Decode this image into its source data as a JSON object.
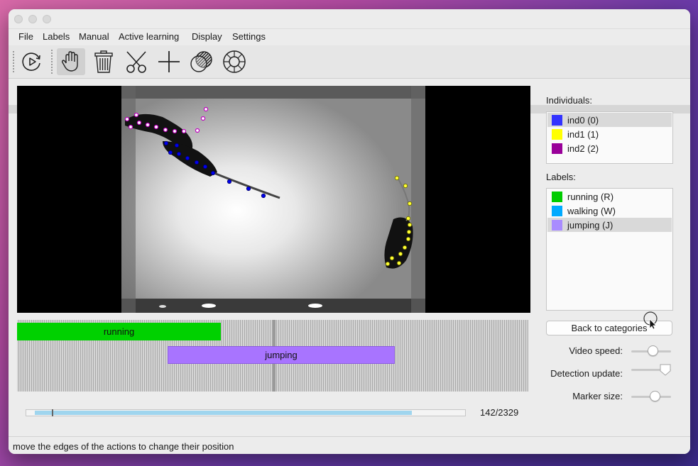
{
  "menu": {
    "items": [
      "File",
      "Labels",
      "Manual",
      "Active learning",
      "Display",
      "Settings"
    ]
  },
  "toolbar": {
    "buttons": [
      {
        "icon": "play-circle-icon"
      },
      {
        "icon": "hand-icon",
        "active": true
      },
      {
        "icon": "trash-icon"
      },
      {
        "icon": "scissors-icon"
      },
      {
        "icon": "plus-icon"
      },
      {
        "icon": "overlap-circles-icon"
      },
      {
        "icon": "lifebuoy-icon"
      }
    ]
  },
  "timeline": {
    "rows": [
      {
        "label": "running",
        "color": "#00d100",
        "start_frac": 0.0,
        "end_frac": 0.398
      },
      {
        "label": "jumping",
        "color": "#a874ff",
        "start_frac": 0.294,
        "end_frac": 0.739
      }
    ]
  },
  "progress": {
    "fill_start_frac": 0.02,
    "fill_end_frac": 0.879,
    "counter": "142/2329"
  },
  "sidebar": {
    "individuals_title": "Individuals:",
    "individuals": [
      {
        "label": "ind0 (0)",
        "color": "#3333ff",
        "selected": true
      },
      {
        "label": "ind1 (1)",
        "color": "#ffff00",
        "selected": false
      },
      {
        "label": "ind2 (2)",
        "color": "#990099",
        "selected": false
      }
    ],
    "labels_title": "Labels:",
    "labels": [
      {
        "label": "running (R)",
        "color": "#00cc00",
        "selected": false
      },
      {
        "label": "walking (W)",
        "color": "#00aaff",
        "selected": false
      },
      {
        "label": "jumping (J)",
        "color": "#a98cff",
        "selected": true
      }
    ],
    "back_button": "Back to categories",
    "sliders": [
      {
        "label": "Video speed:",
        "value": 0.55
      },
      {
        "label": "Detection update:",
        "value": 0.85
      },
      {
        "label": "Marker size:",
        "value": 0.6
      }
    ]
  },
  "status": {
    "message": "move the edges of the actions to change their position"
  }
}
